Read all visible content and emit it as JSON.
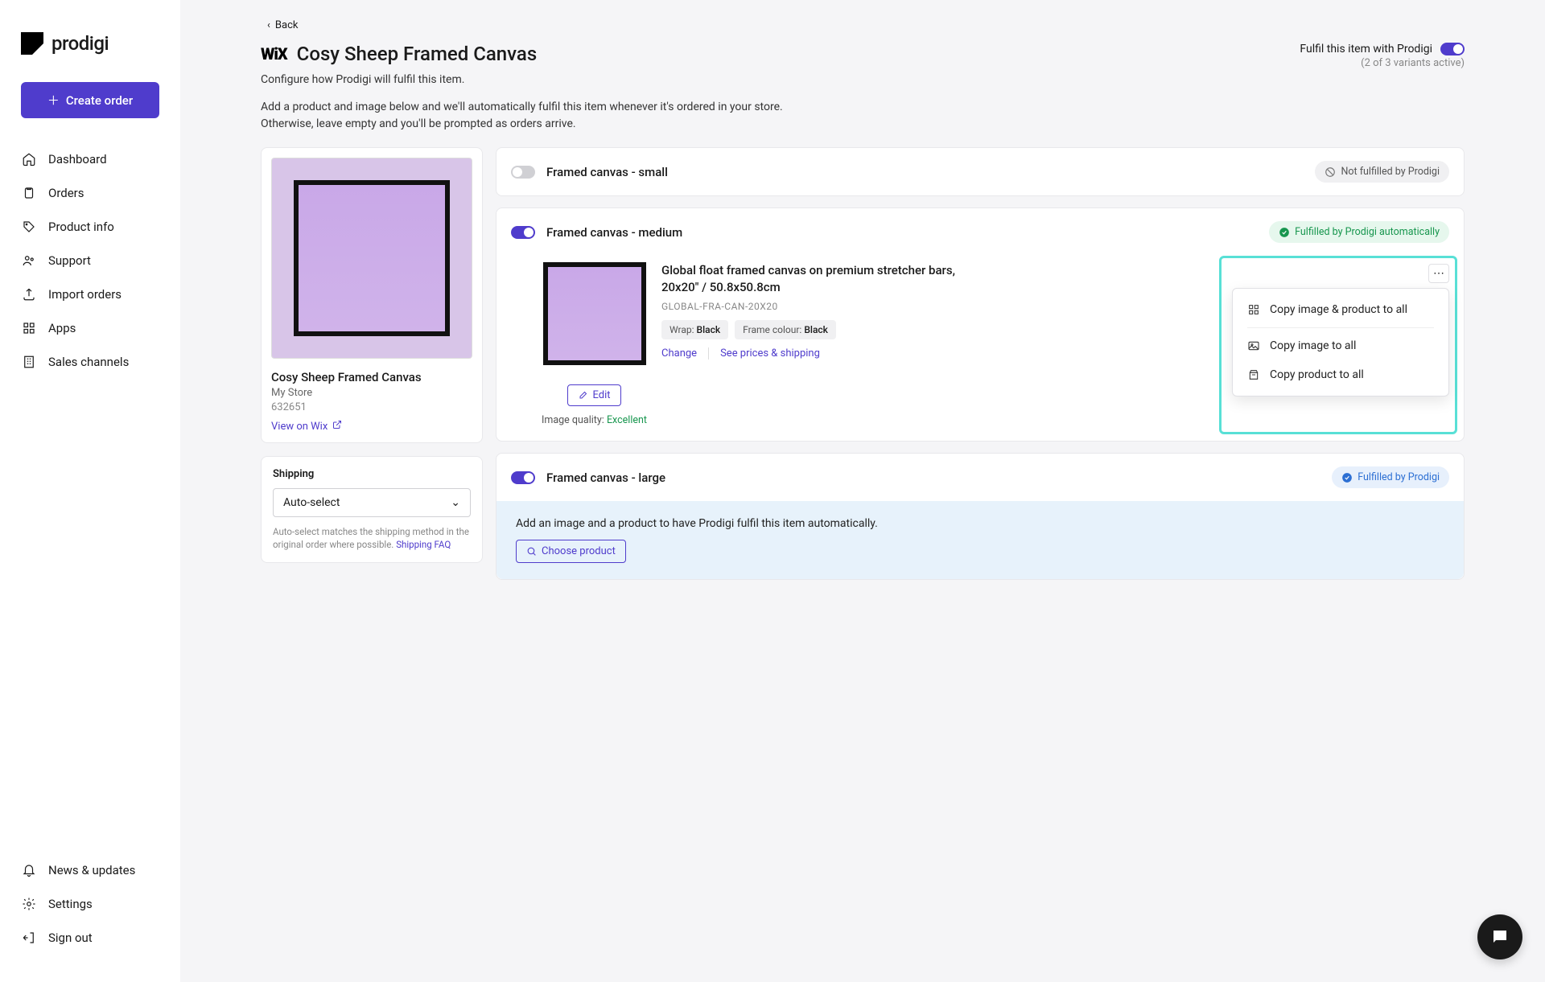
{
  "brand": "prodigi",
  "create_order": "Create order",
  "nav": {
    "dashboard": "Dashboard",
    "orders": "Orders",
    "product_info": "Product info",
    "support": "Support",
    "import_orders": "Import orders",
    "apps": "Apps",
    "sales_channels": "Sales channels",
    "news": "News & updates",
    "settings": "Settings",
    "sign_out": "Sign out"
  },
  "back_label": "Back",
  "platform": "WiX",
  "page_title": "Cosy Sheep Framed Canvas",
  "subtitle": "Configure how Prodigi will fulfil this item.",
  "desc": "Add a product and image below and we'll automatically fulfil this item whenever it's ordered in your store. Otherwise, leave empty and you'll be prompted as orders arrive.",
  "fulfil_label": "Fulfil this item with Prodigi",
  "fulfil_sub": "(2 of 3 variants active)",
  "preview": {
    "title": "Cosy Sheep Framed Canvas",
    "store": "My Store",
    "sku": "632651",
    "view_link": "View on Wix"
  },
  "shipping": {
    "heading": "Shipping",
    "selected": "Auto-select",
    "note_pre": "Auto-select matches the shipping method in the original order where possible. ",
    "faq": "Shipping FAQ"
  },
  "variants": {
    "small": {
      "name": "Framed canvas - small",
      "status": "Not fulfilled by Prodigi"
    },
    "medium": {
      "name": "Framed canvas - medium",
      "status": "Fulfilled by Prodigi automatically",
      "product_name": "Global float framed canvas on premium stretcher bars, 20x20\" / 50.8x50.8cm",
      "product_sku": "GLOBAL-FRA-CAN-20X20",
      "wrap_label": "Wrap:",
      "wrap_value": "Black",
      "frame_label": "Frame colour:",
      "frame_value": "Black",
      "change": "Change",
      "prices": "See prices & shipping",
      "edit": "Edit",
      "quality_label": "Image quality:",
      "quality_value": "Excellent"
    },
    "large": {
      "name": "Framed canvas - large",
      "status": "Fulfilled by Prodigi",
      "prompt": "Add an image and a product to have Prodigi fulfil this item automatically.",
      "choose": "Choose product"
    }
  },
  "context_menu": {
    "copy_all": "Copy image & product to all",
    "copy_image": "Copy image to all",
    "copy_product": "Copy product to all"
  }
}
